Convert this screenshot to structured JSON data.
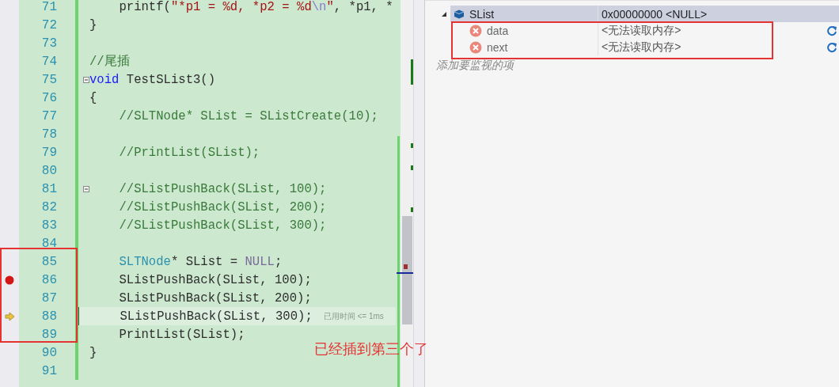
{
  "editor": {
    "lines": [
      {
        "number": "71",
        "tokens": [
          {
            "text": "    printf(",
            "kind": "plain"
          },
          {
            "text": "\"*p1 = %d, *p2 = %d",
            "kind": "string"
          },
          {
            "text": "\\n",
            "kind": "escape"
          },
          {
            "text": "\"",
            "kind": "string"
          },
          {
            "text": ", *p1, *",
            "kind": "plain"
          }
        ]
      },
      {
        "number": "72",
        "tokens": [
          {
            "text": "}",
            "kind": "plain"
          }
        ]
      },
      {
        "number": "73"
      },
      {
        "number": "74",
        "tokens": [
          {
            "text": "//尾插",
            "kind": "comment"
          }
        ]
      },
      {
        "number": "75",
        "fold": true,
        "tokens": [
          {
            "text": "void",
            "kind": "keyword"
          },
          {
            "text": " TestSList3()",
            "kind": "plain"
          }
        ]
      },
      {
        "number": "76",
        "tokens": [
          {
            "text": "{",
            "kind": "plain"
          }
        ]
      },
      {
        "number": "77",
        "tokens": [
          {
            "text": "    //SLTNode* SList = SListCreate(10);",
            "kind": "comment"
          }
        ]
      },
      {
        "number": "78"
      },
      {
        "number": "79",
        "tokens": [
          {
            "text": "    //PrintList(SList);",
            "kind": "comment"
          }
        ]
      },
      {
        "number": "80"
      },
      {
        "number": "81",
        "fold": true,
        "tokens": [
          {
            "text": "    //SListPushBack(SList, 100);",
            "kind": "comment"
          }
        ]
      },
      {
        "number": "82",
        "tokens": [
          {
            "text": "    //SListPushBack(SList, 200);",
            "kind": "comment"
          }
        ]
      },
      {
        "number": "83",
        "tokens": [
          {
            "text": "    //SListPushBack(SList, 300);",
            "kind": "comment"
          }
        ]
      },
      {
        "number": "84"
      },
      {
        "number": "85",
        "tokens": [
          {
            "text": "    SLTNode",
            "kind": "type"
          },
          {
            "text": "* SList = ",
            "kind": "plain"
          },
          {
            "text": "NULL",
            "kind": "macro"
          },
          {
            "text": ";",
            "kind": "plain"
          }
        ]
      },
      {
        "number": "86",
        "breakpoint": true,
        "tokens": [
          {
            "text": "    SListPushBack(SList, 100);",
            "kind": "plain"
          }
        ]
      },
      {
        "number": "87",
        "tokens": [
          {
            "text": "    SListPushBack(SList, 200);",
            "kind": "plain"
          }
        ]
      },
      {
        "number": "88",
        "execution_point": true,
        "current": true,
        "hint": "已用时间 <= 1ms",
        "tokens": [
          {
            "text": "    SListPushBack(SList, 300);",
            "kind": "plain"
          }
        ]
      },
      {
        "number": "89",
        "tokens": [
          {
            "text": "    PrintList(SList);",
            "kind": "plain"
          }
        ]
      },
      {
        "number": "90",
        "tokens": [
          {
            "text": "}",
            "kind": "plain"
          }
        ]
      },
      {
        "number": "91"
      }
    ],
    "annotation": "已经插到第三个了"
  },
  "watch": {
    "rows": [
      {
        "name": "SList",
        "value": "0x00000000 <NULL>",
        "kind": "object",
        "expanded": true,
        "selected": true,
        "children": [
          {
            "name": "data",
            "value": "<无法读取内存>",
            "kind": "error",
            "selected": false
          },
          {
            "name": "next",
            "value": "<无法读取内存>",
            "kind": "error",
            "selected": false
          }
        ]
      }
    ],
    "add_placeholder": "添加要监视的项"
  }
}
